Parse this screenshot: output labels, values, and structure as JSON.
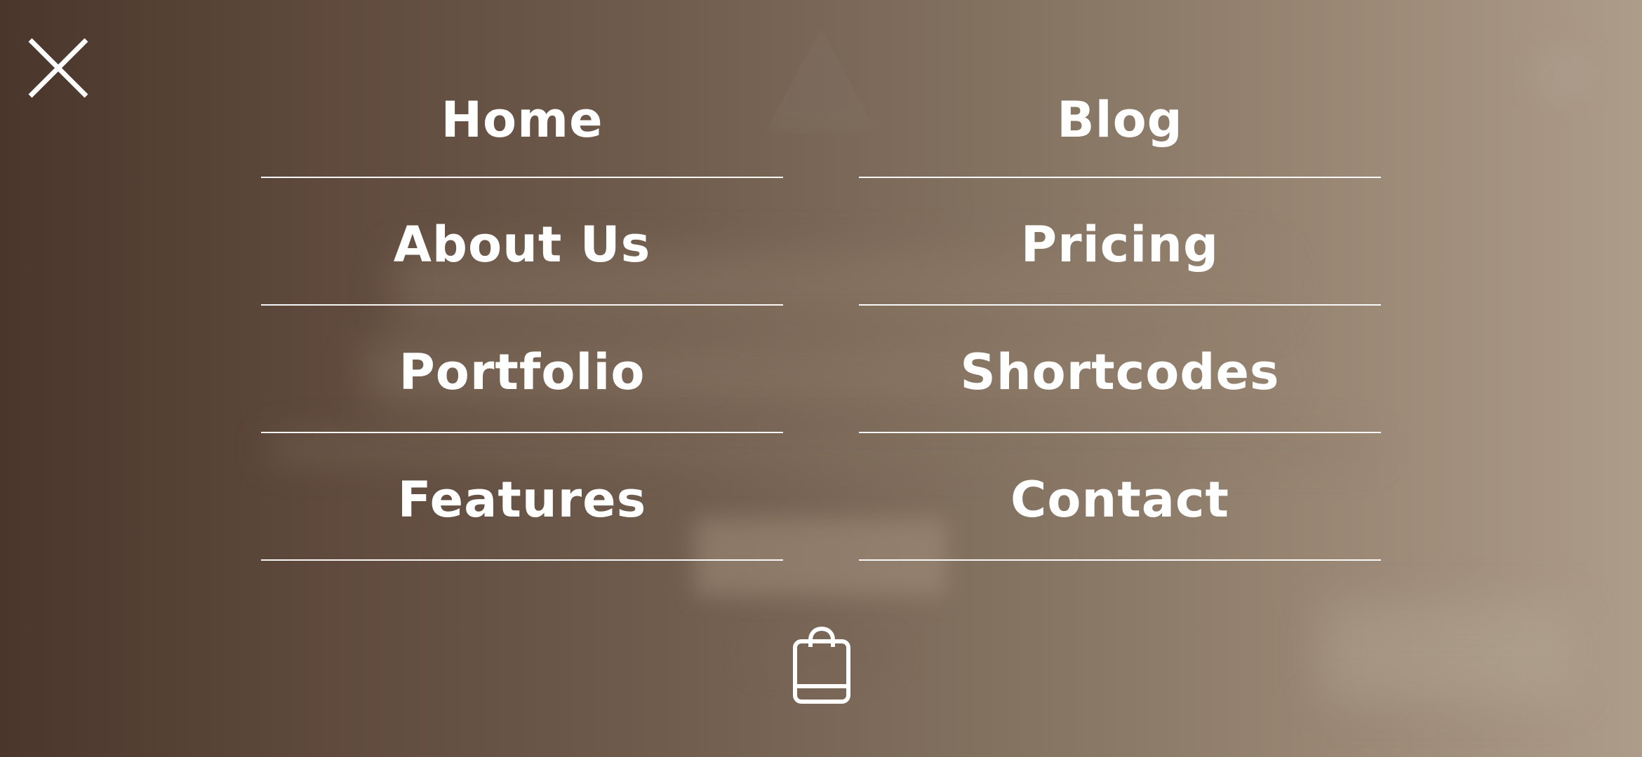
{
  "menu": {
    "items": [
      {
        "label": "Home"
      },
      {
        "label": "Blog"
      },
      {
        "label": "About Us"
      },
      {
        "label": "Pricing"
      },
      {
        "label": "Portfolio"
      },
      {
        "label": "Shortcodes"
      },
      {
        "label": "Features"
      },
      {
        "label": "Contact"
      }
    ]
  },
  "icons": {
    "close": "close-icon",
    "cart": "shopping-bag-icon"
  },
  "colors": {
    "text": "#ffffff",
    "background_start": "#4a362b",
    "background_end": "#ad9c89"
  }
}
